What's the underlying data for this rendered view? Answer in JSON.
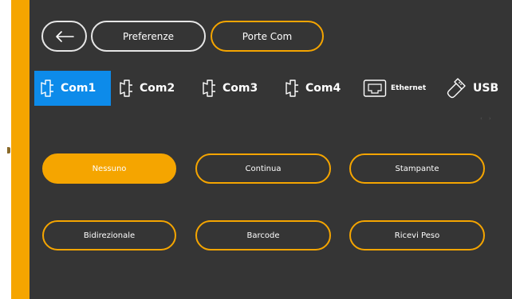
{
  "colors": {
    "accent": "#f5a500",
    "panel": "#353535",
    "active_tab": "#0d8bea",
    "text": "#ffffff"
  },
  "header": {
    "back_icon": "arrow-left-icon",
    "preferences_label": "Preferenze",
    "ports_label": "Porte Com"
  },
  "tabs": [
    {
      "label": "Com1",
      "icon": "serial-connector-icon",
      "active": true
    },
    {
      "label": "Com2",
      "icon": "serial-connector-icon",
      "active": false
    },
    {
      "label": "Com3",
      "icon": "serial-connector-icon",
      "active": false
    },
    {
      "label": "Com4",
      "icon": "serial-connector-icon",
      "active": false
    },
    {
      "label": "Ethernet",
      "icon": "ethernet-port-icon",
      "active": false
    },
    {
      "label": "USB",
      "icon": "usb-stick-icon",
      "active": false
    }
  ],
  "scroll_hint": "‹ ›",
  "modes": {
    "selected": "Nessuno",
    "options": [
      "Nessuno",
      "Continua",
      "Stampante",
      "Bidirezionale",
      "Barcode",
      "Ricevi Peso"
    ]
  }
}
